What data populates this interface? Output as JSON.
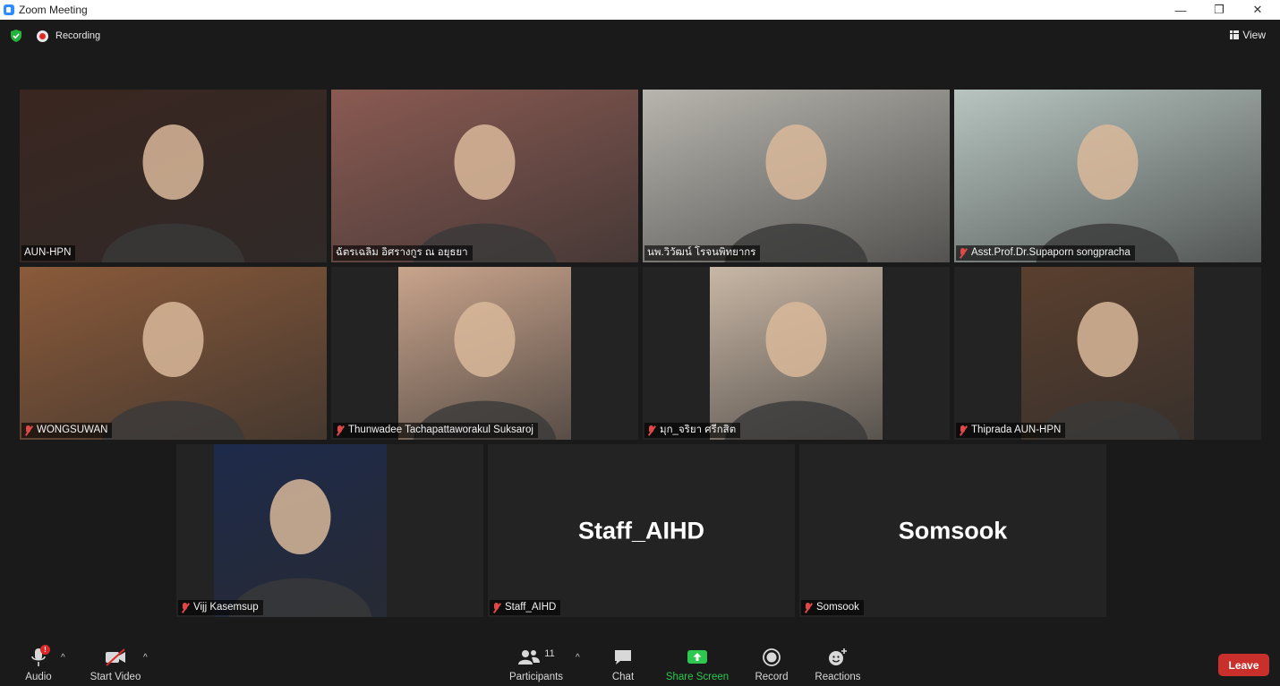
{
  "window": {
    "title": "Zoom Meeting",
    "controls": [
      "—",
      "❐",
      "✕"
    ]
  },
  "topbar": {
    "recording_label": "Recording",
    "view_label": "View"
  },
  "participants": [
    {
      "name": "AUN-HPN",
      "muted": false,
      "active": false,
      "bg": "#3a2620"
    },
    {
      "name": "ฉัตรเฉลิม อิศรางกูร ณ อยุธยา",
      "muted": false,
      "active": true,
      "bg": "#8a5a52"
    },
    {
      "name": "นพ.วิวัฒน์ โรจนพิทยากร",
      "muted": false,
      "active": false,
      "bg": "#b8b5ae"
    },
    {
      "name": "Asst.Prof.Dr.Supaporn songpracha",
      "muted": true,
      "active": false,
      "bg": "#b7c5c0"
    },
    {
      "name": "WONGSUWAN",
      "muted": true,
      "active": false,
      "bg": "#8a5a3a"
    },
    {
      "name": "Thunwadee Tachapattaworakul Suksaroj",
      "muted": true,
      "active": false,
      "bg": "#c9a48c"
    },
    {
      "name": "มุก_จริยา ศรีกสิต",
      "muted": true,
      "active": false,
      "bg": "#c9b7a5"
    },
    {
      "name": "Thiprada AUN-HPN",
      "muted": true,
      "active": false,
      "bg": "#5a3f2e"
    },
    {
      "name": "Vijj Kasemsup",
      "muted": true,
      "active": false,
      "bg": "#1d2a4a"
    },
    {
      "name": "Staff_AIHD",
      "muted": true,
      "active": false,
      "display_name": "Staff_AIHD"
    },
    {
      "name": "Somsook",
      "muted": true,
      "active": false,
      "display_name": "Somsook"
    }
  ],
  "toolbar": {
    "audio_label": "Audio",
    "audio_badge": "!",
    "video_label": "Start Video",
    "participants_label": "Participants",
    "participants_count": "11",
    "chat_label": "Chat",
    "share_label": "Share Screen",
    "record_label": "Record",
    "reactions_label": "Reactions",
    "leave_label": "Leave"
  },
  "colors": {
    "accent_green": "#2ec74f",
    "active_speaker": "#b8d96e",
    "leave_red": "#c9302c",
    "mute_red": "#e04848"
  }
}
